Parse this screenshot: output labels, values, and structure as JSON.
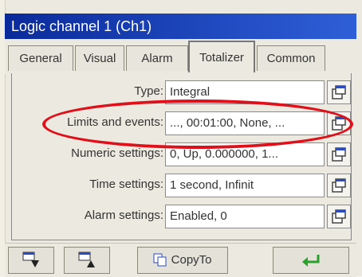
{
  "window": {
    "title": "Logic channel 1 (Ch1)"
  },
  "tabs": [
    {
      "label": "General"
    },
    {
      "label": "Visual"
    },
    {
      "label": "Alarm"
    },
    {
      "label": "Totalizer",
      "active": true
    },
    {
      "label": "Common"
    }
  ],
  "settings": [
    {
      "label": "Type:",
      "value": "Integral"
    },
    {
      "label": "Limits and events:",
      "value": "..., 00:01:00, None, ..."
    },
    {
      "label": "Numeric settings:",
      "value": "0, Up, 0.000000, 1..."
    },
    {
      "label": "Time settings:",
      "value": "1 second, Infinit"
    },
    {
      "label": "Alarm settings:",
      "value": "Enabled, 0"
    }
  ],
  "footer": {
    "copy_label": "CopyTo",
    "icons": [
      "move-down-icon",
      "move-up-icon",
      "copy-icon",
      "enter-icon"
    ]
  },
  "colors": {
    "titlebar": "#0a2a9a",
    "highlight": "#e0101a",
    "enter_arrow": "#2aa02a"
  }
}
